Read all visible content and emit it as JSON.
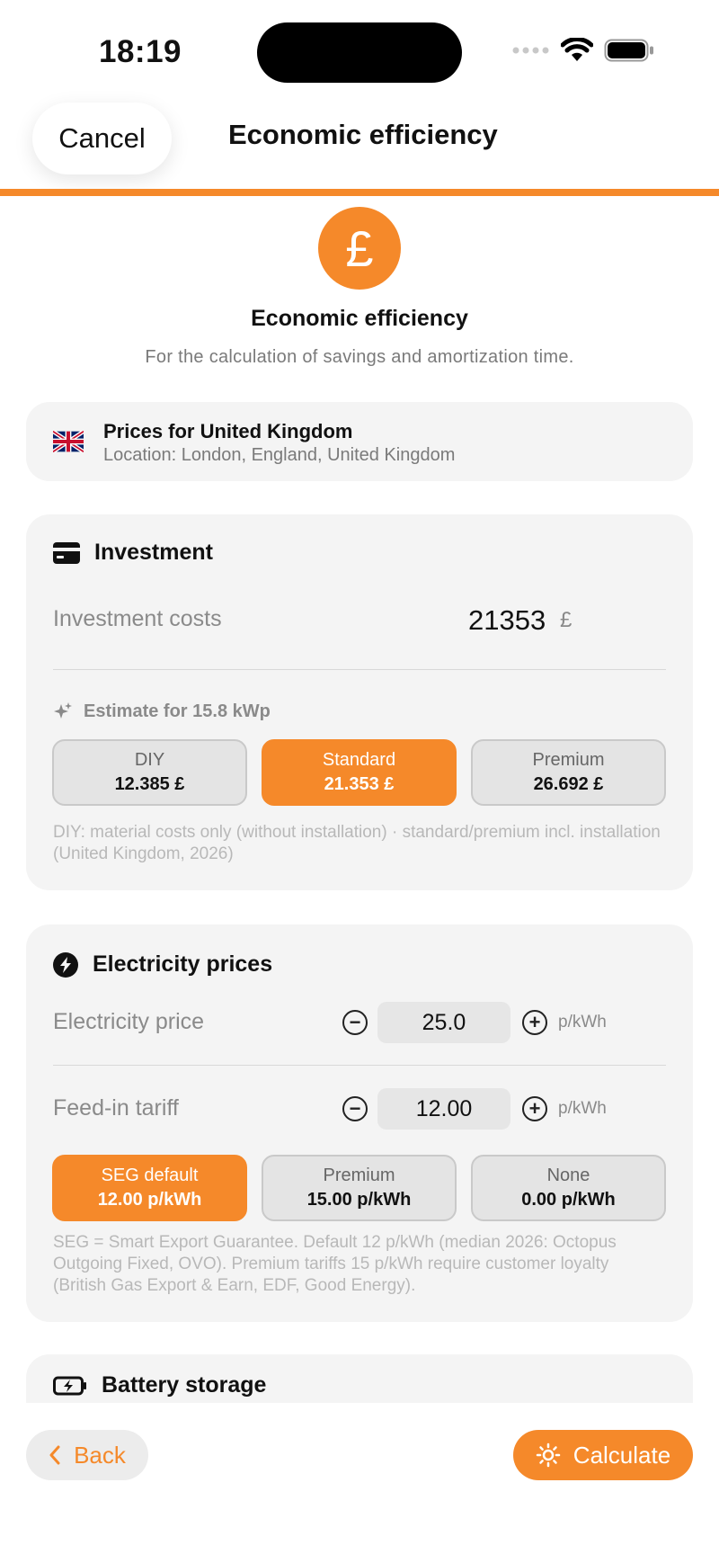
{
  "status": {
    "time": "18:19"
  },
  "nav": {
    "cancel_label": "Cancel",
    "title": "Economic efficiency"
  },
  "hero": {
    "icon": "pound-icon",
    "symbol": "£",
    "title": "Economic efficiency",
    "subtitle": "For the calculation of savings and amortization time."
  },
  "location": {
    "title": "Prices for United Kingdom",
    "subtitle": "Location: London, England, United Kingdom"
  },
  "investment": {
    "heading": "Investment",
    "cost_label": "Investment costs",
    "cost_value": "21353",
    "cost_unit": "£",
    "estimate_label": "Estimate for 15.8 kWp",
    "options": [
      {
        "name": "DIY",
        "price": "12.385 £",
        "active": false
      },
      {
        "name": "Standard",
        "price": "21.353 £",
        "active": true
      },
      {
        "name": "Premium",
        "price": "26.692 £",
        "active": false
      }
    ],
    "note": "DIY: material costs only (without installation) · standard/premium incl. installation (United Kingdom, 2026)"
  },
  "electricity": {
    "heading": "Electricity prices",
    "price_label": "Electricity price",
    "price_value": "25.0",
    "price_unit": "p/kWh",
    "feed_label": "Feed-in tariff",
    "feed_value": "12.00",
    "feed_unit": "p/kWh",
    "options": [
      {
        "name": "SEG default",
        "price": "12.00 p/kWh",
        "active": true
      },
      {
        "name": "Premium",
        "price": "15.00 p/kWh",
        "active": false
      },
      {
        "name": "None",
        "price": "0.00 p/kWh",
        "active": false
      }
    ],
    "note": "SEG = Smart Export Guarantee. Default 12 p/kWh (median 2026: Octopus Outgoing Fixed, OVO). Premium tariffs 15 p/kWh require customer loyalty (British Gas Export & Earn, EDF, Good Energy)."
  },
  "battery": {
    "heading": "Battery storage"
  },
  "footer": {
    "back_label": "Back",
    "calculate_label": "Calculate"
  },
  "colors": {
    "accent": "#f5892a",
    "card": "#f4f4f4",
    "muted": "#8a8a8a"
  }
}
